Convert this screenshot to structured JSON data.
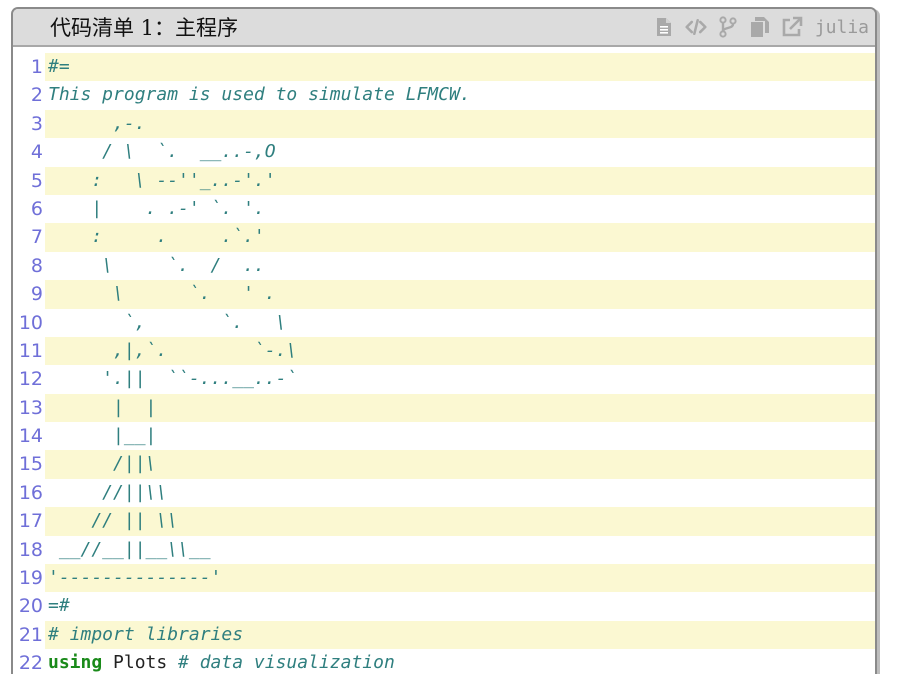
{
  "caption": "代码清单 1：主程序",
  "language": "julia",
  "toolbar": [
    "file-icon",
    "code-icon",
    "branch-icon",
    "copy-icon",
    "external-link-icon"
  ],
  "colors": {
    "comment": "#2f7f7f",
    "keyword": "#1a8a1a",
    "line_number": "#6f6fd8",
    "stripe": "#fbf8d2",
    "header": "#dcdcdc"
  },
  "lines": [
    {
      "n": "1",
      "text": "#=",
      "kw": "",
      "code": "",
      "comment": ""
    },
    {
      "n": "2",
      "text": "This program is used to simulate LFMCW.",
      "kw": "",
      "code": "",
      "comment": ""
    },
    {
      "n": "3",
      "text": "      ,-.",
      "kw": "",
      "code": "",
      "comment": ""
    },
    {
      "n": "4",
      "text": "     / \\  `.  __..-,O",
      "kw": "",
      "code": "",
      "comment": ""
    },
    {
      "n": "5",
      "text": "    :   \\ --''_..-'.'",
      "kw": "",
      "code": "",
      "comment": ""
    },
    {
      "n": "6",
      "text": "    |    . .-' `. '.",
      "kw": "",
      "code": "",
      "comment": ""
    },
    {
      "n": "7",
      "text": "    :     .     .`.'",
      "kw": "",
      "code": "",
      "comment": ""
    },
    {
      "n": "8",
      "text": "     \\     `.  /  ..",
      "kw": "",
      "code": "",
      "comment": ""
    },
    {
      "n": "9",
      "text": "      \\      `.   ' .",
      "kw": "",
      "code": "",
      "comment": ""
    },
    {
      "n": "10",
      "text": "       `,       `.   \\",
      "kw": "",
      "code": "",
      "comment": ""
    },
    {
      "n": "11",
      "text": "      ,|,`.        `-.\\",
      "kw": "",
      "code": "",
      "comment": ""
    },
    {
      "n": "12",
      "text": "     '.||  ``-...__..-`",
      "kw": "",
      "code": "",
      "comment": ""
    },
    {
      "n": "13",
      "text": "      |  |",
      "kw": "",
      "code": "",
      "comment": ""
    },
    {
      "n": "14",
      "text": "      |__|",
      "kw": "",
      "code": "",
      "comment": ""
    },
    {
      "n": "15",
      "text": "      /||\\",
      "kw": "",
      "code": "",
      "comment": ""
    },
    {
      "n": "16",
      "text": "     //||\\\\",
      "kw": "",
      "code": "",
      "comment": ""
    },
    {
      "n": "17",
      "text": "    // || \\\\",
      "kw": "",
      "code": "",
      "comment": ""
    },
    {
      "n": "18",
      "text": " __//__||__\\\\__",
      "kw": "",
      "code": "",
      "comment": ""
    },
    {
      "n": "19",
      "text": "'--------------'",
      "kw": "",
      "code": "",
      "comment": ""
    },
    {
      "n": "20",
      "text": "=#",
      "kw": "",
      "code": "",
      "comment": ""
    },
    {
      "n": "21",
      "text": "# import libraries",
      "kw": "",
      "code": "",
      "comment": ""
    },
    {
      "n": "22",
      "text": "",
      "kw": "using",
      "code": " Plots ",
      "comment": "# data visualization"
    }
  ]
}
